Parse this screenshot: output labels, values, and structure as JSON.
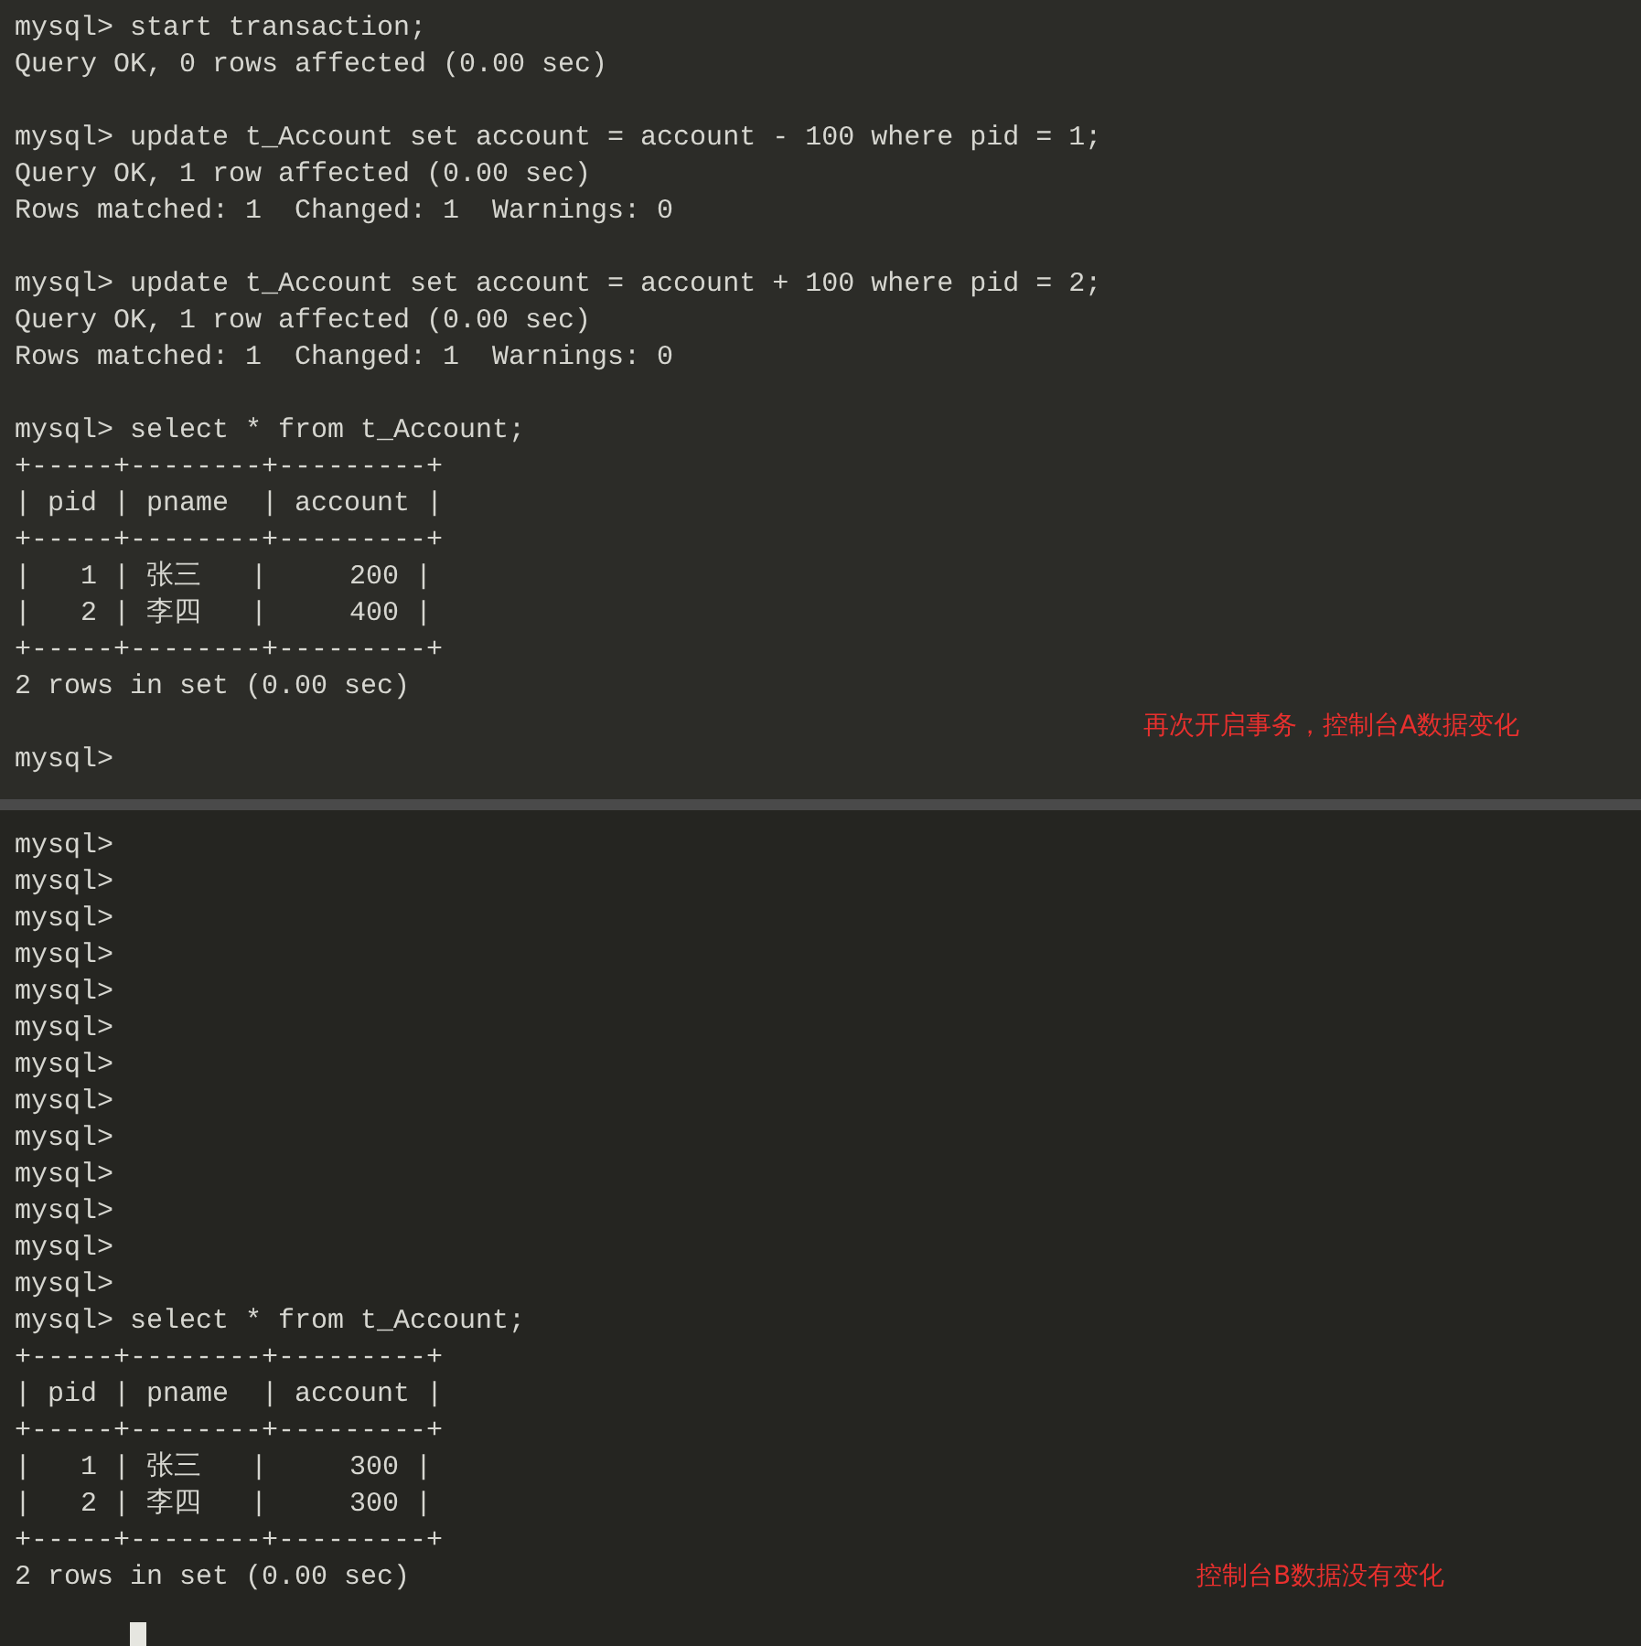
{
  "panes": [
    {
      "blocks": [
        [
          "mysql> start transaction;",
          "Query OK, 0 rows affected (0.00 sec)"
        ],
        [
          "mysql> update t_Account set account = account - 100 where pid = 1;",
          "Query OK, 1 row affected (0.00 sec)",
          "Rows matched: 1  Changed: 1  Warnings: 0"
        ],
        [
          "mysql> update t_Account set account = account + 100 where pid = 2;",
          "Query OK, 1 row affected (0.00 sec)",
          "Rows matched: 1  Changed: 1  Warnings: 0"
        ],
        [
          "mysql> select * from t_Account;",
          "+-----+--------+---------+",
          "| pid | pname  | account |",
          "+-----+--------+---------+",
          "|   1 | 张三   |     200 |",
          "|   2 | 李四   |     400 |",
          "+-----+--------+---------+",
          "2 rows in set (0.00 sec)"
        ],
        [
          "mysql>"
        ]
      ],
      "note": "再次开启事务，控制台A数据变化"
    },
    {
      "blocks": [
        [
          "mysql>",
          "mysql>",
          "mysql>",
          "mysql>",
          "mysql>",
          "mysql>",
          "mysql>",
          "mysql>",
          "mysql>",
          "mysql>",
          "mysql>",
          "mysql>",
          "mysql>",
          "mysql> select * from t_Account;",
          "+-----+--------+---------+",
          "| pid | pname  | account |",
          "+-----+--------+---------+",
          "|   1 | 张三   |     300 |",
          "|   2 | 李四   |     300 |",
          "+-----+--------+---------+",
          "2 rows in set (0.00 sec)"
        ]
      ],
      "note": "控制台B数据没有变化",
      "cursor": true
    }
  ]
}
